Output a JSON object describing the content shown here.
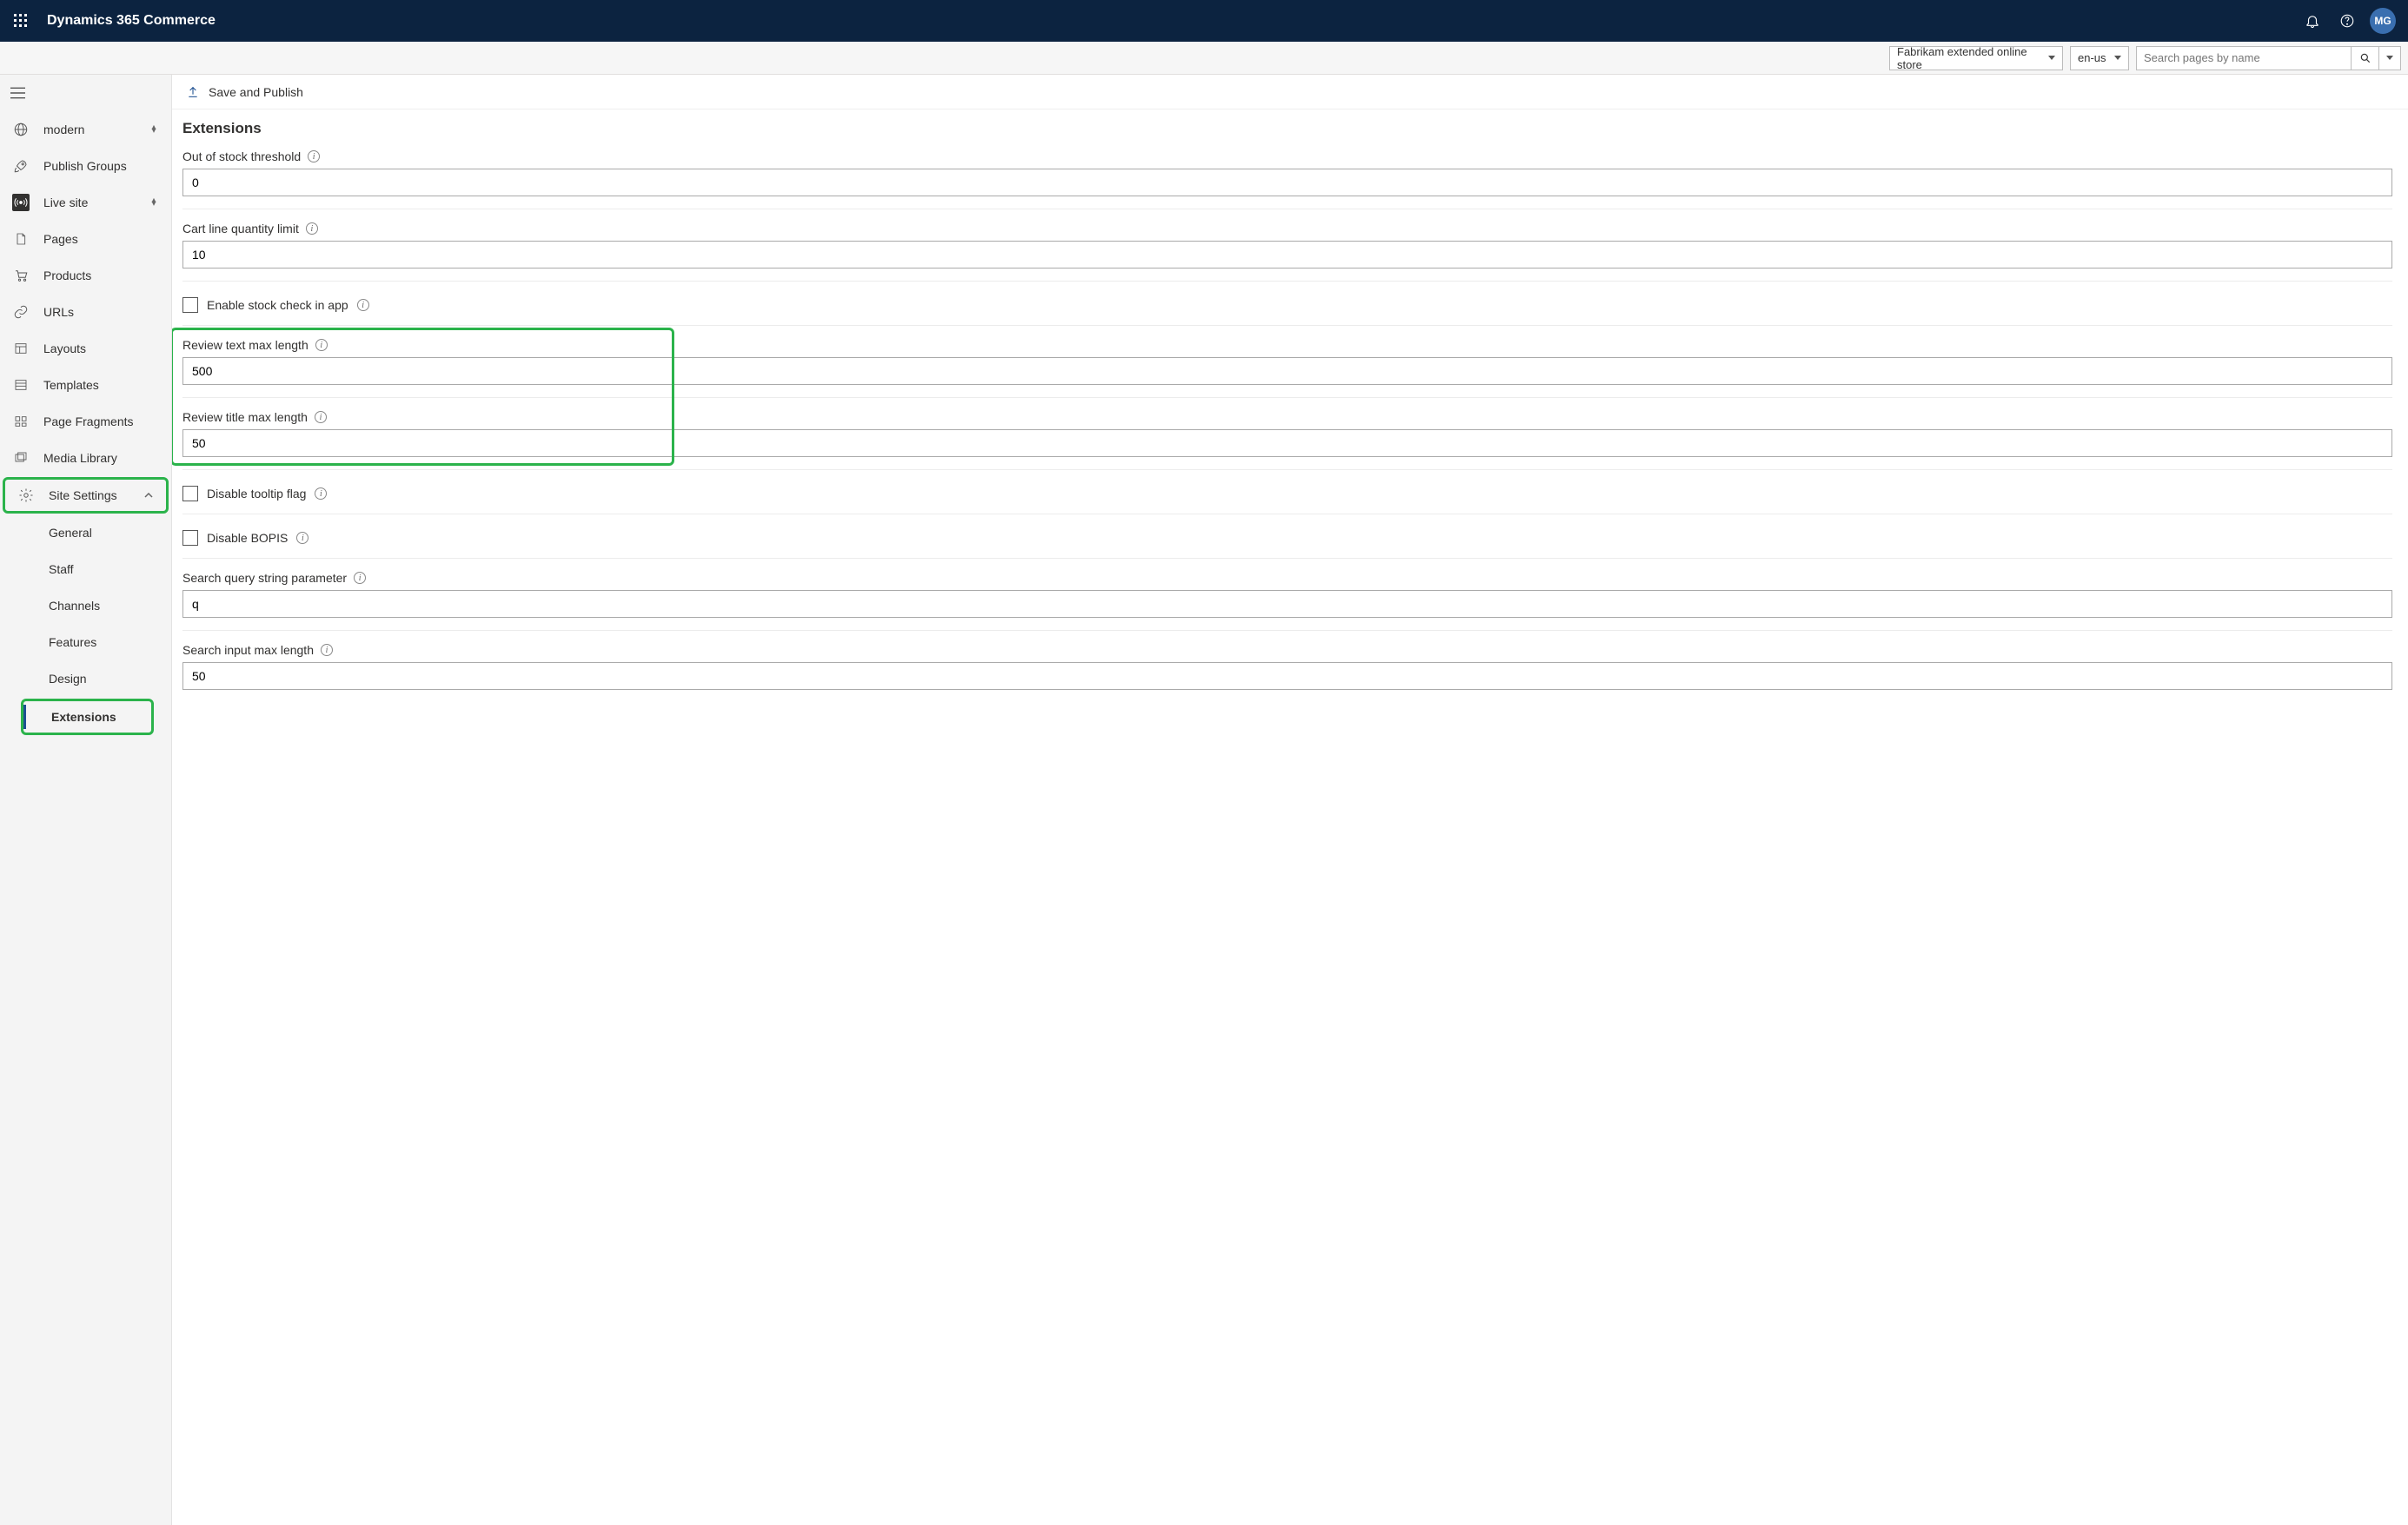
{
  "header": {
    "app_name": "Dynamics 365 Commerce",
    "avatar_initials": "MG"
  },
  "subbar": {
    "store": "Fabrikam extended online store",
    "language": "en-us",
    "search_placeholder": "Search pages by name"
  },
  "sidebar": {
    "modern": "modern",
    "publish_groups": "Publish Groups",
    "live_site": "Live site",
    "pages": "Pages",
    "products": "Products",
    "urls": "URLs",
    "layouts": "Layouts",
    "templates": "Templates",
    "page_fragments": "Page Fragments",
    "media_library": "Media Library",
    "site_settings": "Site Settings",
    "sub": {
      "general": "General",
      "staff": "Staff",
      "channels": "Channels",
      "features": "Features",
      "design": "Design",
      "extensions": "Extensions"
    }
  },
  "actionbar": {
    "save_and_publish": "Save and Publish"
  },
  "main": {
    "title": "Extensions",
    "fields": {
      "out_of_stock": {
        "label": "Out of stock threshold",
        "value": "0"
      },
      "cart_line_qty": {
        "label": "Cart line quantity limit",
        "value": "10"
      },
      "enable_stock_check": {
        "label": "Enable stock check in app"
      },
      "review_text_max": {
        "label": "Review text max length",
        "value": "500"
      },
      "review_title_max": {
        "label": "Review title max length",
        "value": "50"
      },
      "disable_tooltip": {
        "label": "Disable tooltip flag"
      },
      "disable_bopis": {
        "label": "Disable BOPIS"
      },
      "search_query_param": {
        "label": "Search query string parameter",
        "value": "q"
      },
      "search_input_max": {
        "label": "Search input max length",
        "value": "50"
      }
    }
  }
}
